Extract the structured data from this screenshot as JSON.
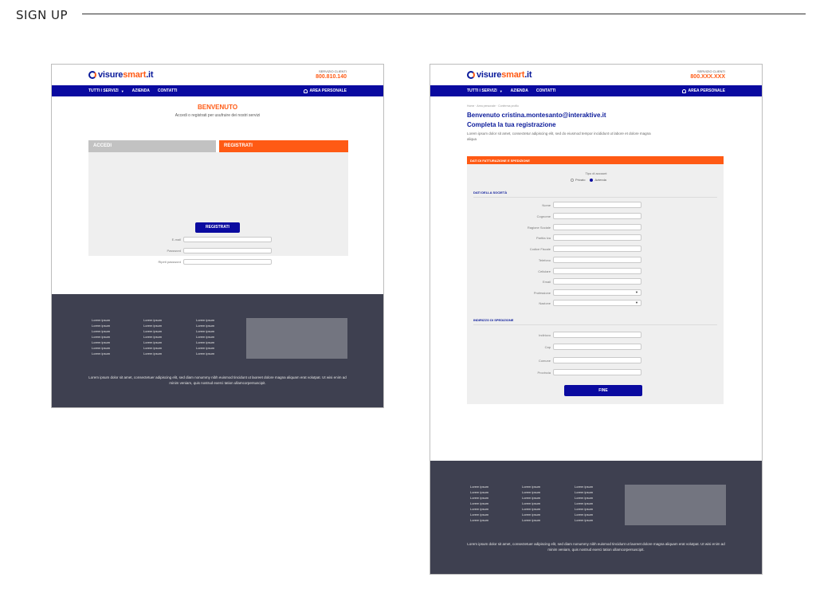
{
  "sheet": {
    "title": "SIGN UP"
  },
  "header": {
    "logo": {
      "a": "visure",
      "b": "smart",
      "c": ".it"
    },
    "service_label": "SERVIZIO CLIENTI",
    "phone_a": "800.810.140",
    "phone_b": "800.XXX.XXX",
    "nav": [
      "TUTTI I SERVIZI",
      "AZIENDA",
      "CONTATTI"
    ],
    "area": "AREA PERSONALE"
  },
  "signup": {
    "title": "BENVENUTO",
    "subtitle": "Accedi o registrati per usufruire dei nostri servizi",
    "tab_accedi": "ACCEDI",
    "tab_registrati": "REGISTRATI",
    "fields": [
      "E-mail",
      "Password",
      "Ripeti password"
    ],
    "submit": "REGISTRATI"
  },
  "complete": {
    "breadcrumb": "Home · Area personale · Conferma profilo",
    "greeting": "Benvenuto cristina.montesanto@interaktive.it",
    "heading": "Completa la tua registrazione",
    "intro": "Lorem ipsum dolor sit amet, consectetur adipiscing elit, sed do eiusmod tempor incididunt ut labore et dolore magna aliqua",
    "section": "DATI DI FATTURAZIONE E SPEDIZIONE",
    "tipo_label": "Tipo di account",
    "tipo_options": [
      "Privato",
      "Azienda"
    ],
    "company_heading": "DATI DELLA SOCIETÀ",
    "company_fields": [
      "Nome",
      "Cognome",
      "Ragione Sociale",
      "Partita Iva",
      "Codice Fiscale",
      "Telefono",
      "Cellulare",
      "Email",
      "Professione",
      "Nazione"
    ],
    "shipping_heading": "INDIRIZZO DI SPEDIZIONE",
    "shipping_fields": [
      "Indirizzo",
      "Cap",
      "Comune",
      "Provincia"
    ],
    "submit": "FINE"
  },
  "footer": {
    "link": "Lorem ipsum",
    "text": "Lorem ipsum dolor sit amet, consectetuer adipiscing elit, sed diam nonummy nibh euismod tincidunt ut laoreet dolore magna aliquam erat volutpat. Ut wisi enim ad minim veniam, quis nostrud exerci tation ullamcorpersuscipit."
  },
  "colors": {
    "brand_blue": "#0a0aa0",
    "accent_orange": "#ff5a14",
    "footer_bg": "#3e4050",
    "panel_bg": "#efefef"
  }
}
